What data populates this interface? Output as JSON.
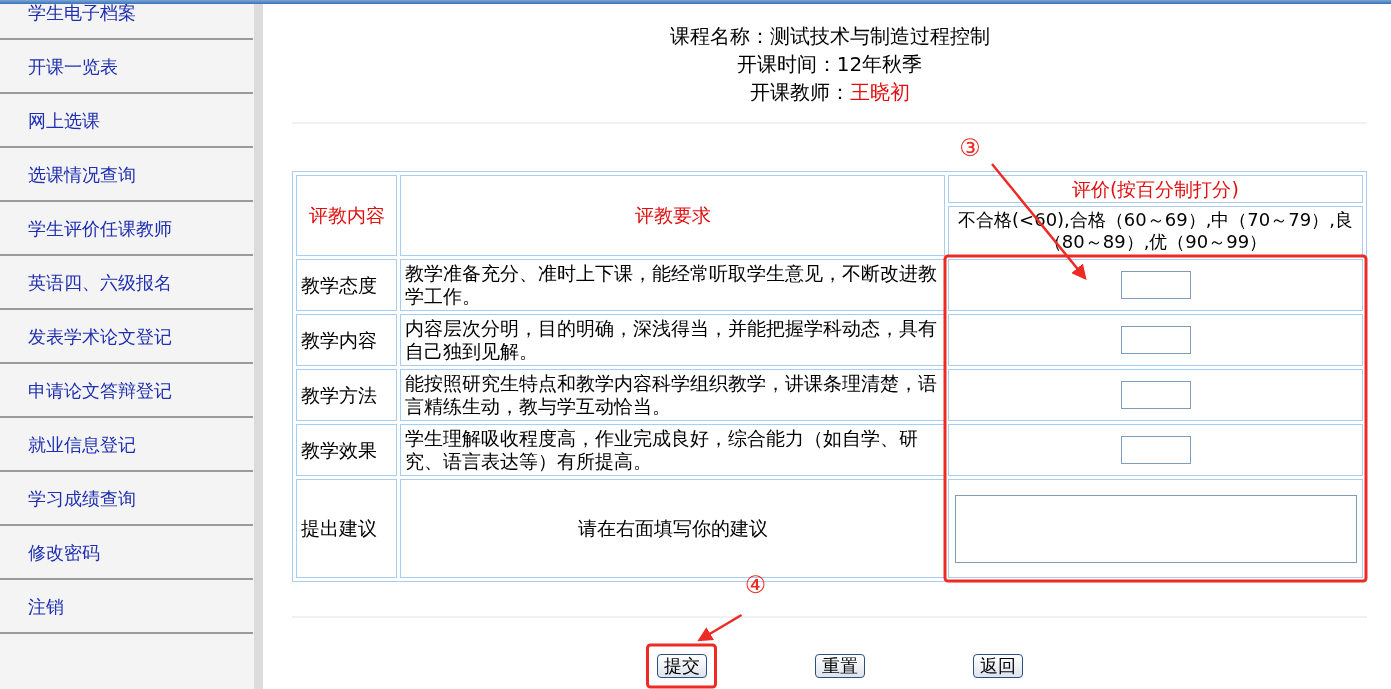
{
  "sidebar": {
    "items": [
      {
        "label": "学生电子档案"
      },
      {
        "label": "开课一览表"
      },
      {
        "label": "网上选课"
      },
      {
        "label": "选课情况查询"
      },
      {
        "label": "学生评价任课教师"
      },
      {
        "label": "英语四、六级报名"
      },
      {
        "label": "发表学术论文登记"
      },
      {
        "label": "申请论文答辩登记"
      },
      {
        "label": "就业信息登记"
      },
      {
        "label": "学习成绩查询"
      },
      {
        "label": "修改密码"
      },
      {
        "label": "注销"
      }
    ]
  },
  "course": {
    "name_label": "课程名称：",
    "name": "测试技术与制造过程控制",
    "time_label": "开课时间：",
    "time": "12年秋季",
    "teacher_label": "开课教师：",
    "teacher": "王晓初"
  },
  "table": {
    "columns": [
      "评教内容",
      "评教要求",
      "评价(按百分制打分)"
    ],
    "scale_note": "不合格(<60),合格（60～69）,中（70～79）,良（80～89）,优（90～99）",
    "rows": [
      {
        "kind": "score",
        "aspect": "教学态度",
        "requirement": "教学准备充分、准时上下课，能经常听取学生意见，不断改进教学工作。"
      },
      {
        "kind": "score",
        "aspect": "教学内容",
        "requirement": "内容层次分明，目的明确，深浅得当，并能把握学科动态，具有自己独到见解。"
      },
      {
        "kind": "score",
        "aspect": "教学方法",
        "requirement": "能按照研究生特点和教学内容科学组织教学，讲课条理清楚，语言精练生动，教与学互动恰当。"
      },
      {
        "kind": "score",
        "aspect": "教学效果",
        "requirement": "学生理解吸收程度高，作业完成良好，综合能力（如自学、研究、语言表达等）有所提高。"
      },
      {
        "kind": "suggestion",
        "aspect": "提出建议",
        "requirement": "请在右面填写你的建议"
      }
    ]
  },
  "buttons": [
    {
      "label": "提交"
    },
    {
      "label": "重置"
    },
    {
      "label": "返回"
    }
  ],
  "annotations": [
    {
      "label": "③",
      "kind": "scores"
    },
    {
      "label": "④",
      "kind": "submit"
    }
  ]
}
